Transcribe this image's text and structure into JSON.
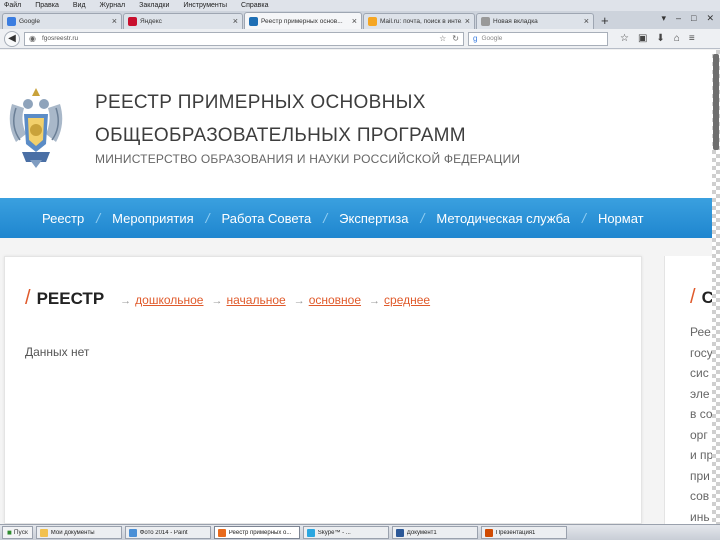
{
  "menubar": [
    "Файл",
    "Правка",
    "Вид",
    "Журнал",
    "Закладки",
    "Инструменты",
    "Справка"
  ],
  "tabs": [
    {
      "label": "Google",
      "color": "#3b7de0",
      "active": false
    },
    {
      "label": "Яндекс",
      "color": "#c8102e",
      "active": false
    },
    {
      "label": "Реестр примерных основ...",
      "color": "#1e6fb5",
      "active": true
    },
    {
      "label": "Mail.ru: почта, поиск в инте...",
      "color": "#f5a623",
      "active": false
    },
    {
      "label": "Новая вкладка",
      "color": "#999999",
      "active": false
    }
  ],
  "navbar": {
    "url": "fgosreestr.ru",
    "search_placeholder": "Google"
  },
  "header": {
    "title_line1": "РЕЕСТР ПРИМЕРНЫХ ОСНОВНЫХ",
    "title_line2": "ОБЩЕОБРАЗОВАТЕЛЬНЫХ ПРОГРАММ",
    "ministry": "МИНИСТЕРСТВО ОБРАЗОВАНИЯ И НАУКИ РОССИЙСКОЙ ФЕДЕРАЦИИ"
  },
  "mainnav": [
    "Реестр",
    "Мероприятия",
    "Работа Совета",
    "Экспертиза",
    "Методическая служба",
    "Нормат"
  ],
  "content": {
    "slash": "/",
    "title": "РЕЕСТР",
    "arrow": "→",
    "links": [
      "дошкольное",
      "начальное",
      "основное",
      "среднее"
    ],
    "empty_message": "Данных нет"
  },
  "sidebar": {
    "title_letter": "С",
    "text_lines": [
      "Рее",
      "госу",
      "сис",
      "эле",
      "в со",
      "орг",
      "и пр",
      "при",
      "сов",
      "инь"
    ]
  },
  "taskbar": {
    "start_label": "Пуск",
    "buttons": [
      {
        "label": "Мои документы",
        "color": "#f2c14e",
        "active": false
      },
      {
        "label": "Фото 2014 - Paint",
        "color": "#4a8fd6",
        "active": false
      },
      {
        "label": "Реестр примерных о...",
        "color": "#e86a1c",
        "active": true
      },
      {
        "label": "Skype™ - ...",
        "color": "#2aa6e0",
        "active": false
      },
      {
        "label": "Документ1",
        "color": "#2b5797",
        "active": false
      },
      {
        "label": "Презентация1",
        "color": "#d04a02",
        "active": false
      }
    ]
  },
  "colors": {
    "accent": "#e05a2b",
    "nav_blue": "#2a93d8"
  }
}
